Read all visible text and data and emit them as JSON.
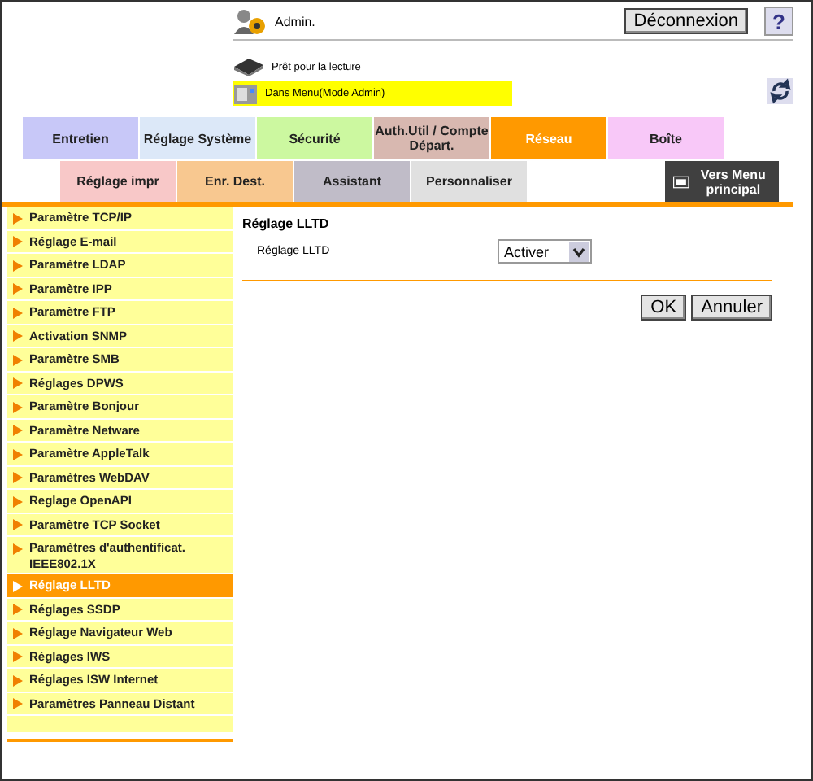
{
  "header": {
    "user": "Admin.",
    "logout_button": "Déconnexion",
    "help_button": "?",
    "scanner_status": "Prêt pour la lecture",
    "printer_status": "Dans Menu(Mode Admin)"
  },
  "tabs": [
    {
      "label": "Entretien",
      "color": "#c8c8f8",
      "selected": false
    },
    {
      "label": "Réglage Système",
      "color": "#dce8f8",
      "selected": false
    },
    {
      "label": "Sécurité",
      "color": "#ccf8a0",
      "selected": false
    },
    {
      "label": "Auth.Util / Compte Départ.",
      "color": "#d8b8b0",
      "selected": false
    },
    {
      "label": "Réseau",
      "color": "#ff9900",
      "selected": true
    },
    {
      "label": "Boîte",
      "color": "#f8c8f8",
      "selected": false
    }
  ],
  "subtabs": [
    {
      "label": "Réglage impr",
      "color": "#f8c8c8",
      "selected": false
    },
    {
      "label": "Enr. Dest.",
      "color": "#f8c890",
      "selected": false
    },
    {
      "label": "Assistant",
      "color": "#c0bcc8",
      "selected": false
    },
    {
      "label": "Personnaliser",
      "color": "#e0e0e0",
      "selected": false
    }
  ],
  "main_menu_button": "Vers Menu principal",
  "sidebar": {
    "items": [
      {
        "label": "Paramètre TCP/IP",
        "selected": false
      },
      {
        "label": "Réglage E-mail",
        "selected": false
      },
      {
        "label": "Paramètre LDAP",
        "selected": false
      },
      {
        "label": "Paramètre IPP",
        "selected": false
      },
      {
        "label": "Paramètre FTP",
        "selected": false
      },
      {
        "label": "Activation SNMP",
        "selected": false
      },
      {
        "label": "Paramètre SMB",
        "selected": false
      },
      {
        "label": "Réglages DPWS",
        "selected": false
      },
      {
        "label": "Paramètre Bonjour",
        "selected": false
      },
      {
        "label": "Paramètre Netware",
        "selected": false
      },
      {
        "label": "Paramètre AppleTalk",
        "selected": false
      },
      {
        "label": "Paramètres WebDAV",
        "selected": false
      },
      {
        "label": "Reglage OpenAPI",
        "selected": false
      },
      {
        "label": "Paramètre TCP Socket",
        "selected": false
      },
      {
        "label": "Paramètres d'authentificat. IEEE802.1X",
        "selected": false
      },
      {
        "label": "Réglage LLTD",
        "selected": true
      },
      {
        "label": "Réglages SSDP",
        "selected": false
      },
      {
        "label": "Réglage Navigateur Web",
        "selected": false
      },
      {
        "label": "Réglages IWS",
        "selected": false
      },
      {
        "label": "Réglages ISW Internet",
        "selected": false
      },
      {
        "label": "Paramètres Panneau Distant",
        "selected": false
      }
    ]
  },
  "content": {
    "title": "Réglage LLTD",
    "field_label": "Réglage LLTD",
    "field_value": "Activer",
    "buttons": [
      "OK",
      "Annuler"
    ]
  }
}
